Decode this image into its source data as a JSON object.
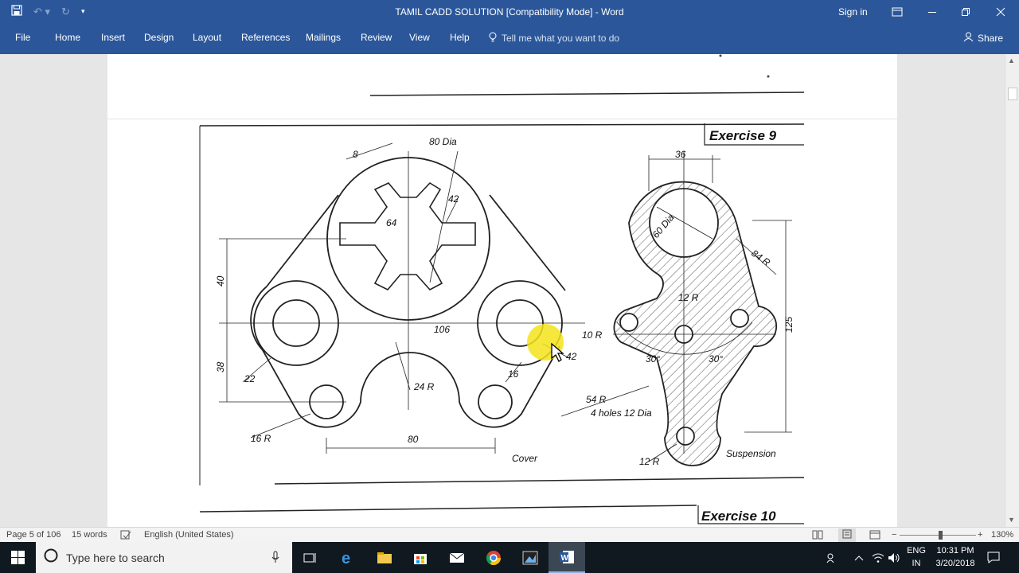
{
  "window": {
    "title": "TAMIL CADD SOLUTION [Compatibility Mode]  -  Word",
    "sign_in": "Sign in",
    "minimize_icon": "minimize-icon",
    "restore_icon": "restore-icon",
    "close_icon": "close-icon"
  },
  "qat": {
    "save_icon": "save-icon",
    "undo_icon": "undo-icon",
    "redo_icon": "redo-icon",
    "customize_icon": "chevron-down-icon"
  },
  "ribbon": {
    "tabs": [
      "File",
      "Home",
      "Insert",
      "Design",
      "Layout",
      "References",
      "Mailings",
      "Review",
      "View",
      "Help"
    ],
    "tell_me": "Tell me what you want to do",
    "share": "Share"
  },
  "drawing": {
    "exercise9": "Exercise  9",
    "exercise10": "Exercise  10",
    "left_title": "Cover",
    "right_title": "Suspension",
    "dims_left": [
      "8",
      "80 Dia",
      "42",
      "64",
      "40",
      "106",
      "38",
      "22",
      "24 R",
      "16",
      "16 R",
      "80",
      "42"
    ],
    "dims_right": [
      "36",
      "60 Dia",
      "84 R",
      "12 R",
      "10 R",
      "125",
      "30°",
      "30°",
      "54 R",
      "4 holes 12 Dia",
      "12 R"
    ]
  },
  "status": {
    "page": "Page 5 of 106",
    "words": "15 words",
    "language": "English (United States)",
    "zoom": "130%"
  },
  "taskbar": {
    "search_placeholder": "Type here to search",
    "lang_line1": "ENG",
    "lang_line2": "IN",
    "time": "10:31 PM",
    "date": "3/20/2018"
  },
  "colors": {
    "word_blue": "#2b579a",
    "taskbar": "#101820",
    "highlight": "#f5e31a"
  }
}
